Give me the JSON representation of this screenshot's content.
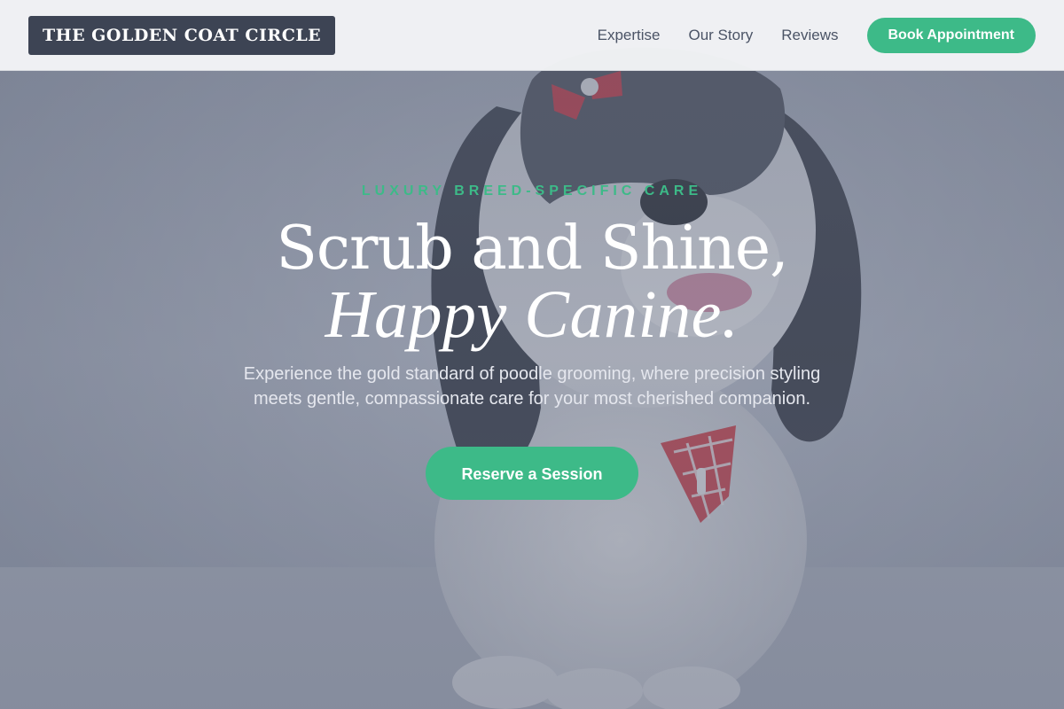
{
  "brand": {
    "name": "THE GOLDEN COAT CIRCLE"
  },
  "nav": {
    "links": [
      "Expertise",
      "Our Story",
      "Reviews"
    ],
    "cta_label": "Book Appointment"
  },
  "hero": {
    "eyebrow": "LUXURY BREED-SPECIFIC CARE",
    "headline_line1": "Scrub and Shine,",
    "headline_line2": "Happy Canine.",
    "subtitle": "Experience the gold standard of poodle grooming, where precision styling meets gentle, compassionate care for your most cherished companion.",
    "cta_label": "Reserve a Session",
    "background_image": "shaggy-dog-with-red-bow-and-bandana-photo"
  },
  "colors": {
    "accent": "#3dba88",
    "logo_bg": "#3d4454",
    "header_bg": "#f3f4f6",
    "nav_text": "#4b5466",
    "hero_overlay": "#60687c"
  }
}
